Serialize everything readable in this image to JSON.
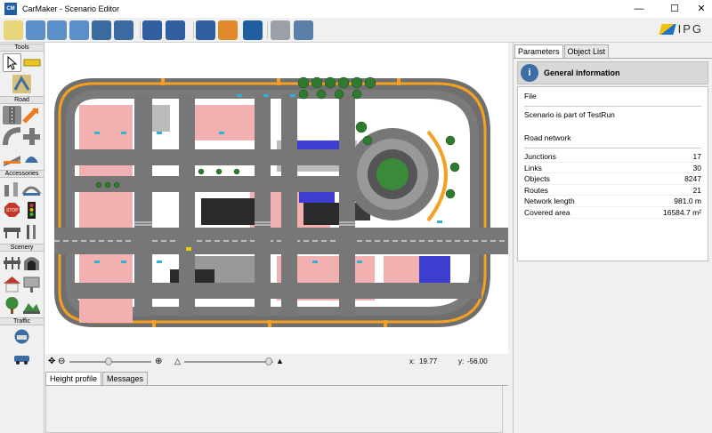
{
  "window": {
    "title": "CarMaker - Scenario Editor",
    "app_icon_text": "CM",
    "minimize": "—",
    "maximize": "☐",
    "close": "✕"
  },
  "toolbar": {
    "buttons": [
      {
        "name": "new-icon",
        "color": "#e8d67a"
      },
      {
        "name": "open-icon",
        "color": "#5a8fc8"
      },
      {
        "name": "import-icon",
        "color": "#5a8fc8"
      },
      {
        "name": "export-icon",
        "color": "#5a8fc8"
      },
      {
        "name": "save-icon",
        "color": "#3b6aa0"
      },
      {
        "name": "save-as-icon",
        "color": "#3b6aa0"
      },
      {
        "name": "undo-icon",
        "color": "#2f5f9f"
      },
      {
        "name": "redo-icon",
        "color": "#2f5f9f"
      },
      {
        "name": "info-icon",
        "color": "#2f5f9f"
      },
      {
        "name": "help-icon",
        "color": "#e08a2a"
      },
      {
        "name": "play-icon",
        "color": "#1f5fa0"
      },
      {
        "name": "settings-icon",
        "color": "#9aa0a6"
      },
      {
        "name": "screen-icon",
        "color": "#5a7fa8"
      }
    ],
    "brand": "IPG"
  },
  "palette": {
    "sections": [
      "Tools",
      "Road",
      "Accessories",
      "Scenery",
      "Traffic"
    ],
    "colors": {
      "road": "#8a8a8a",
      "yellow": "#e8c520",
      "arrow": "#ee7a20",
      "house": "#c0392b",
      "tree": "#3a8a3a",
      "car": "#3a6ea5"
    }
  },
  "map": {
    "background": "#ffffff"
  },
  "status": {
    "x_label": "x:",
    "x_value": "19.77",
    "y_label": "y:",
    "y_value": "-56.00"
  },
  "bottom_tabs": [
    "Height profile",
    "Messages"
  ],
  "right": {
    "tabs": [
      "Parameters",
      "Object List"
    ],
    "heading": "General information",
    "file_label": "File",
    "file_text": "Scenario is part of TestRun",
    "road_label": "Road network",
    "stats": [
      {
        "label": "Junctions",
        "value": "17"
      },
      {
        "label": "Links",
        "value": "30"
      },
      {
        "label": "Objects",
        "value": "8247"
      },
      {
        "label": "Routes",
        "value": "21"
      },
      {
        "label": "Network length",
        "value": "981.0 m"
      },
      {
        "label": "Covered area",
        "value": "16584.7 m²"
      }
    ]
  }
}
